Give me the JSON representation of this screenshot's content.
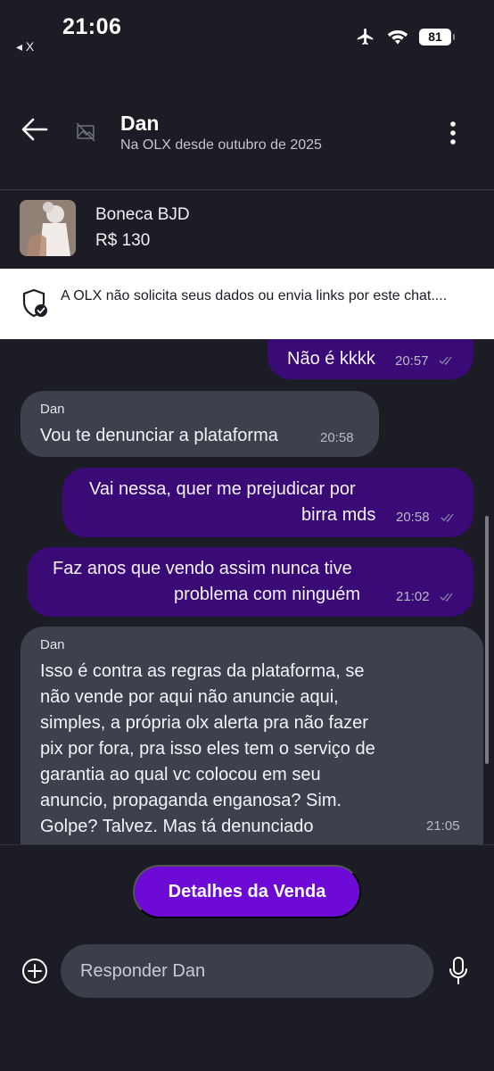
{
  "status_bar": {
    "time": "21:06",
    "back_app": "◂ X",
    "battery": "81"
  },
  "header": {
    "name": "Dan",
    "subtitle": "Na OLX desde outubro de 2025"
  },
  "product": {
    "title": "Boneca BJD",
    "price": "R$ 130"
  },
  "warning": {
    "text": "A OLX não solicita seus dados ou envia links por este chat...."
  },
  "messages": [
    {
      "direction": "out",
      "text": "Não é kkkk",
      "time": "20:57"
    },
    {
      "direction": "in",
      "sender": "Dan",
      "text": "Vou te denunciar a plataforma",
      "time": "20:58"
    },
    {
      "direction": "out",
      "line1": "Vai nessa, quer me prejudicar por",
      "line2": "birra mds",
      "time": "20:58"
    },
    {
      "direction": "out",
      "line1": "Faz anos que vendo assim nunca tive",
      "line2": "problema com ninguém",
      "time": "21:02"
    },
    {
      "direction": "in",
      "sender": "Dan",
      "lines": [
        "Isso é contra as regras da plataforma, se",
        "não vende por aqui não anuncie aqui,",
        "simples, a própria olx alerta pra não fazer",
        "pix por fora, pra isso eles tem o serviço de",
        "garantia ao qual vc colocou em seu",
        "anuncio, propaganda enganosa? Sim.",
        "Golpe? Talvez.  Mas tá denunciado"
      ],
      "time": "21:05"
    }
  ],
  "actions": {
    "sale_details": "Detalhes da Venda"
  },
  "reply": {
    "placeholder": "Responder Dan"
  },
  "colors": {
    "background": "#1b1c24",
    "outgoing": "#3a0a77",
    "incoming": "#3d404d",
    "accent": "#6e0ad6"
  }
}
